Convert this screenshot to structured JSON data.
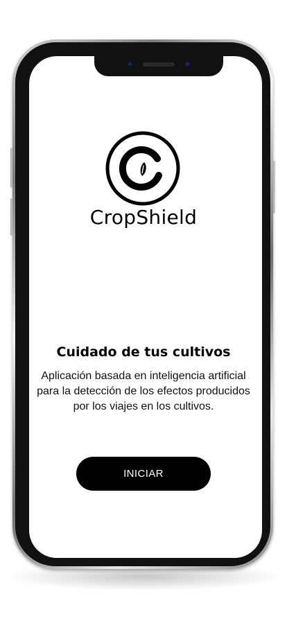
{
  "brand": {
    "name": "CropShield",
    "logo_icon": "cropshield-logo-icon"
  },
  "main": {
    "heading": "Cuidado de tus cultivos",
    "description": "Aplicación basada en inteligencia artificial para la detección de los efectos producidos por los viajes en los cultivos."
  },
  "actions": {
    "start_label": "INICIAR"
  },
  "colors": {
    "button_background": "#000000",
    "button_text": "#ffffff",
    "screen_background": "#ffffff",
    "text": "#000000"
  }
}
